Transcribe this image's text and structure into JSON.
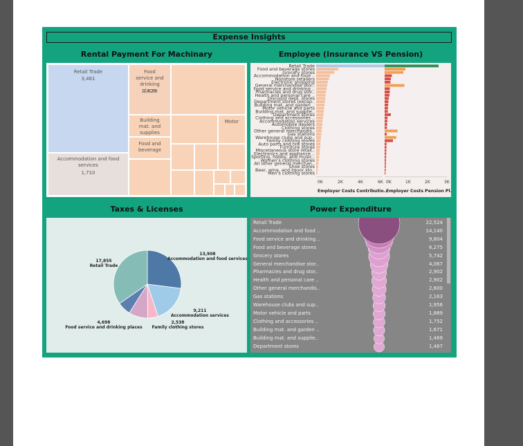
{
  "dashboard": {
    "title": "Expense Insights"
  },
  "panels": {
    "rental": "Rental Payment For Machinary",
    "employee": "Employee  (Insurance VS Pension)",
    "taxes": "Taxes & Licenses",
    "power": "Power Expenditure"
  },
  "colors": {
    "background": "#14a37f",
    "page": "#ffffff",
    "outer": "#555555"
  },
  "chart_data": [
    {
      "type": "treemap",
      "title": "Rental Payment For Machinary",
      "items": [
        {
          "label": "Retail Trade",
          "value": 3461,
          "value_text": "3,461",
          "color": "#c6d7ef"
        },
        {
          "label": "Accommodation and food services",
          "value": 1710,
          "value_text": "1,710",
          "color": "#e7dfdc"
        },
        {
          "label": "Food service and drinking places",
          "value": 1028,
          "value_text": "1,028",
          "color": "#f7d2bb"
        },
        {
          "label": "Building mat. and supplies",
          "value": null,
          "value_text": "",
          "color": "#f8d3b7"
        },
        {
          "label": "Food and beverage",
          "value": null,
          "value_text": "",
          "color": "#f8d3b7"
        },
        {
          "label": "Motor",
          "value": null,
          "value_text": "",
          "color": "#f8d3b7"
        }
      ]
    },
    {
      "type": "bar",
      "title": "Employee  (Insurance VS Pension)",
      "categories": [
        "Retail Trade",
        "Food and beverage stores",
        "Grocery stores",
        "Accommodation and food ..",
        "Nonstore retailers",
        "Electronic shopping",
        "General merchandise stor..",
        "Food service and drinking ..",
        "Pharmacies and drug stor..",
        "Health and personal care ..",
        "Discount dept. stores",
        "Department stores (excep..",
        "Building mat. and garden ..",
        "Motor vehicle and parts",
        "Building mat. and supplie..",
        "Department stores",
        "Clothing and accessories ..",
        "Accommodation services",
        "Automobile dealers",
        "Clothing stores",
        "Other general merchandis..",
        "Gas stations",
        "Warehouse clubs and sup..",
        "Family clothing stores",
        "Auto parts and tire stores",
        "Furniture stores",
        "Miscellaneous store retail..",
        "Electronics and appliance ..",
        "Sporting, hobby, and music..",
        "Women's clothing stores",
        "All other general merchan..",
        "Shoe stores",
        "Beer, wine, and liquor sto..",
        "Men's clothing stores"
      ],
      "series": [
        {
          "name": "Employer Costs Contributio..",
          "color": "#f3bf9f",
          "values": [
            6200,
            2000,
            1650,
            1250,
            1150,
            1050,
            1000,
            950,
            900,
            850,
            830,
            800,
            760,
            720,
            690,
            660,
            620,
            580,
            560,
            530,
            500,
            470,
            440,
            410,
            380,
            360,
            330,
            300,
            270,
            240,
            210,
            180,
            150,
            120
          ]
        },
        {
          "name": "Employer Costs Pension Pl..",
          "color": "#d94b45",
          "values": [
            2600,
            1000,
            900,
            350,
            300,
            280,
            950,
            250,
            250,
            230,
            200,
            180,
            170,
            160,
            150,
            300,
            140,
            130,
            120,
            110,
            620,
            100,
            560,
            400,
            90,
            85,
            80,
            75,
            70,
            65,
            60,
            55,
            50,
            40
          ]
        }
      ],
      "x1_ticks": [
        "0K",
        "2K",
        "4K",
        "6K"
      ],
      "x2_ticks": [
        "0K",
        "1K",
        "2K",
        "3K"
      ],
      "x1_max": 6000,
      "x2_max": 3000
    },
    {
      "type": "pie",
      "title": "Taxes & Licenses",
      "slices": [
        {
          "label": "Accommodation and food services",
          "value": 13908,
          "value_text": "13,908",
          "color": "#4e79a7"
        },
        {
          "label": "Accommodation services",
          "value": 9211,
          "value_text": "9,211",
          "color": "#a0cbe8"
        },
        {
          "label": "Family clothing stores",
          "value": 2538,
          "value_text": "2,538",
          "color": "#f6b8c8"
        },
        {
          "label": "Food service and drinking places",
          "value": 4698,
          "value_text": "4,698",
          "color": "#d4a6c8"
        },
        {
          "label": "",
          "value": 3300,
          "value_text": "",
          "color": "#5b7fae"
        },
        {
          "label": "Retail Trade",
          "value": 17855,
          "value_text": "17,855",
          "color": "#86bcb6"
        }
      ]
    },
    {
      "type": "bubble",
      "title": "Power Expenditure",
      "categories": [
        "Retail Trade",
        "Accommodation and food ..",
        "Food service and drinking ..",
        "Food and beverage stores",
        "Grocery stores",
        "General merchandise stor..",
        "Pharmacies and drug stor..",
        "Health and personal care ..",
        "Other general merchandis..",
        "Gas stations",
        "Warehouse clubs and sup..",
        "Motor vehicle and parts",
        "Clothing and accessories ..",
        "Building mat. and garden ..",
        "Building mat. and supplie..",
        "Department stores"
      ],
      "values": [
        22524,
        14140,
        9804,
        6275,
        5742,
        4067,
        2902,
        2902,
        2600,
        2163,
        1956,
        1889,
        1752,
        1671,
        1469,
        1467
      ],
      "value_labels": [
        "22,524",
        "14,140",
        "9,804",
        "6,275",
        "5,742",
        "4,067",
        "2,902",
        "2,902",
        "2,600",
        "2,163",
        "1,956",
        "1,889",
        "1,752",
        "1,671",
        "1,469",
        "1,467"
      ]
    }
  ]
}
